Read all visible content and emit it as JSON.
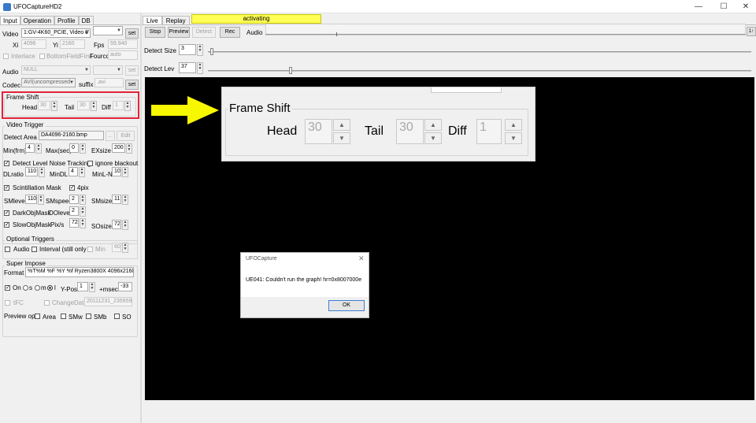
{
  "window": {
    "title": "UFOCaptureHD2",
    "min": "—",
    "max": "☐",
    "close": "✕"
  },
  "left": {
    "tabs": [
      "Input",
      "Operation",
      "Profile",
      "DB"
    ],
    "video": {
      "label": "Video",
      "combo": "1:GV-4K60_PCIE, Video 0'",
      "set": "set"
    },
    "dims": {
      "xi_label": "Xi",
      "xi": "4096",
      "yi_label": "Yi",
      "yi": "2160",
      "fps_label": "Fps",
      "fps": "59.940"
    },
    "interlace": {
      "interlace": "Interlace",
      "bff": "BottomFieldFirst",
      "fourcc_label": "Fourcc",
      "fourcc": "auto"
    },
    "audio": {
      "label": "Audio",
      "combo": "NULL",
      "set": "set"
    },
    "codec": {
      "label": "Codec",
      "combo": "AVI(uncompressed",
      "suffix_label": "suffix",
      "suffix": ".avi",
      "set": "set"
    },
    "frame_shift": {
      "title": "Frame Shift",
      "head_label": "Head",
      "head": "30",
      "tail_label": "Tail",
      "tail": "30",
      "diff_label": "Diff",
      "diff": "1"
    },
    "video_trigger": {
      "title": "Video Trigger",
      "detect_area_label": "Detect Area",
      "detect_area": "DA4096-2160.bmp",
      "dots": "...",
      "edit": "Edit",
      "min_label": "Min(frm)",
      "min": "4",
      "max_label": "Max(sec)",
      "max": "0",
      "exsize_label": "EXsize",
      "exsize": "200",
      "noise": "Detect Level Noise Tracking",
      "ignore": "ignore blackout",
      "dlratio_label": "DLratio",
      "dlratio": "110",
      "mindl_label": "MinDL",
      "mindl": "4",
      "minln_label": "MinL-N",
      "minln": "10",
      "scint": "Scintillation Mask",
      "fourpix": "4pix",
      "smlevel_label": "SMlevel",
      "smlevel": "110",
      "smspeed_label": "SMspeed",
      "smspeed": "2",
      "smsize_label": "SMsize",
      "smsize": "11",
      "dark": "DarkObjMask",
      "dolevel_label": "DOlevel",
      "dolevel": "2",
      "slow": "SlowObjMask",
      "pixs_label": "Pix/s",
      "pixs": "72",
      "sosize_label": "SOsize",
      "sosize": "72"
    },
    "optional": {
      "title": "Optional Triggers",
      "audio": "Audio",
      "interval": "Interval (still only",
      "min_label": "Min",
      "min": "60"
    },
    "super": {
      "title": "Super Impose",
      "format_label": "Format",
      "format": "%T%M %F %Y %f  Ryzen3800X  4096x2160.",
      "on": "On",
      "s": "s",
      "m": "m",
      "l": "l",
      "ypos_label": "Y-Pos",
      "ypos": "1",
      "msec_label": "+msec",
      "msec": "-33",
      "tfc": "tFC",
      "change": "ChangeDate",
      "date": "20111231_235959",
      "preview_label": "Preview opt",
      "area": "Area",
      "smw": "SMw",
      "smb": "SMb",
      "so": "SO"
    }
  },
  "right": {
    "tabs": [
      "Live",
      "Replay"
    ],
    "status": "activating",
    "stop": "Stop",
    "preview": "Preview",
    "detect": "Detect",
    "rec": "Rec",
    "audio": "Audio",
    "detect_size_label": "Detect Size",
    "detect_size": "3",
    "detect_lev_label": "Detect Lev",
    "detect_lev": "37",
    "scroll_btn": "1↑"
  },
  "zoom": {
    "title": "Frame Shift",
    "head_label": "Head",
    "head": "30",
    "tail_label": "Tail",
    "tail": "30",
    "diff_label": "Diff",
    "diff": "1"
  },
  "dialog": {
    "title": "UFOCapture",
    "message": "UE041: Couldn't run the graph! hr=0x8007000e",
    "ok": "OK"
  },
  "colors": {
    "highlight": "#e0243a",
    "arrow": "#f7f700",
    "status_bg": "#ffff55"
  }
}
